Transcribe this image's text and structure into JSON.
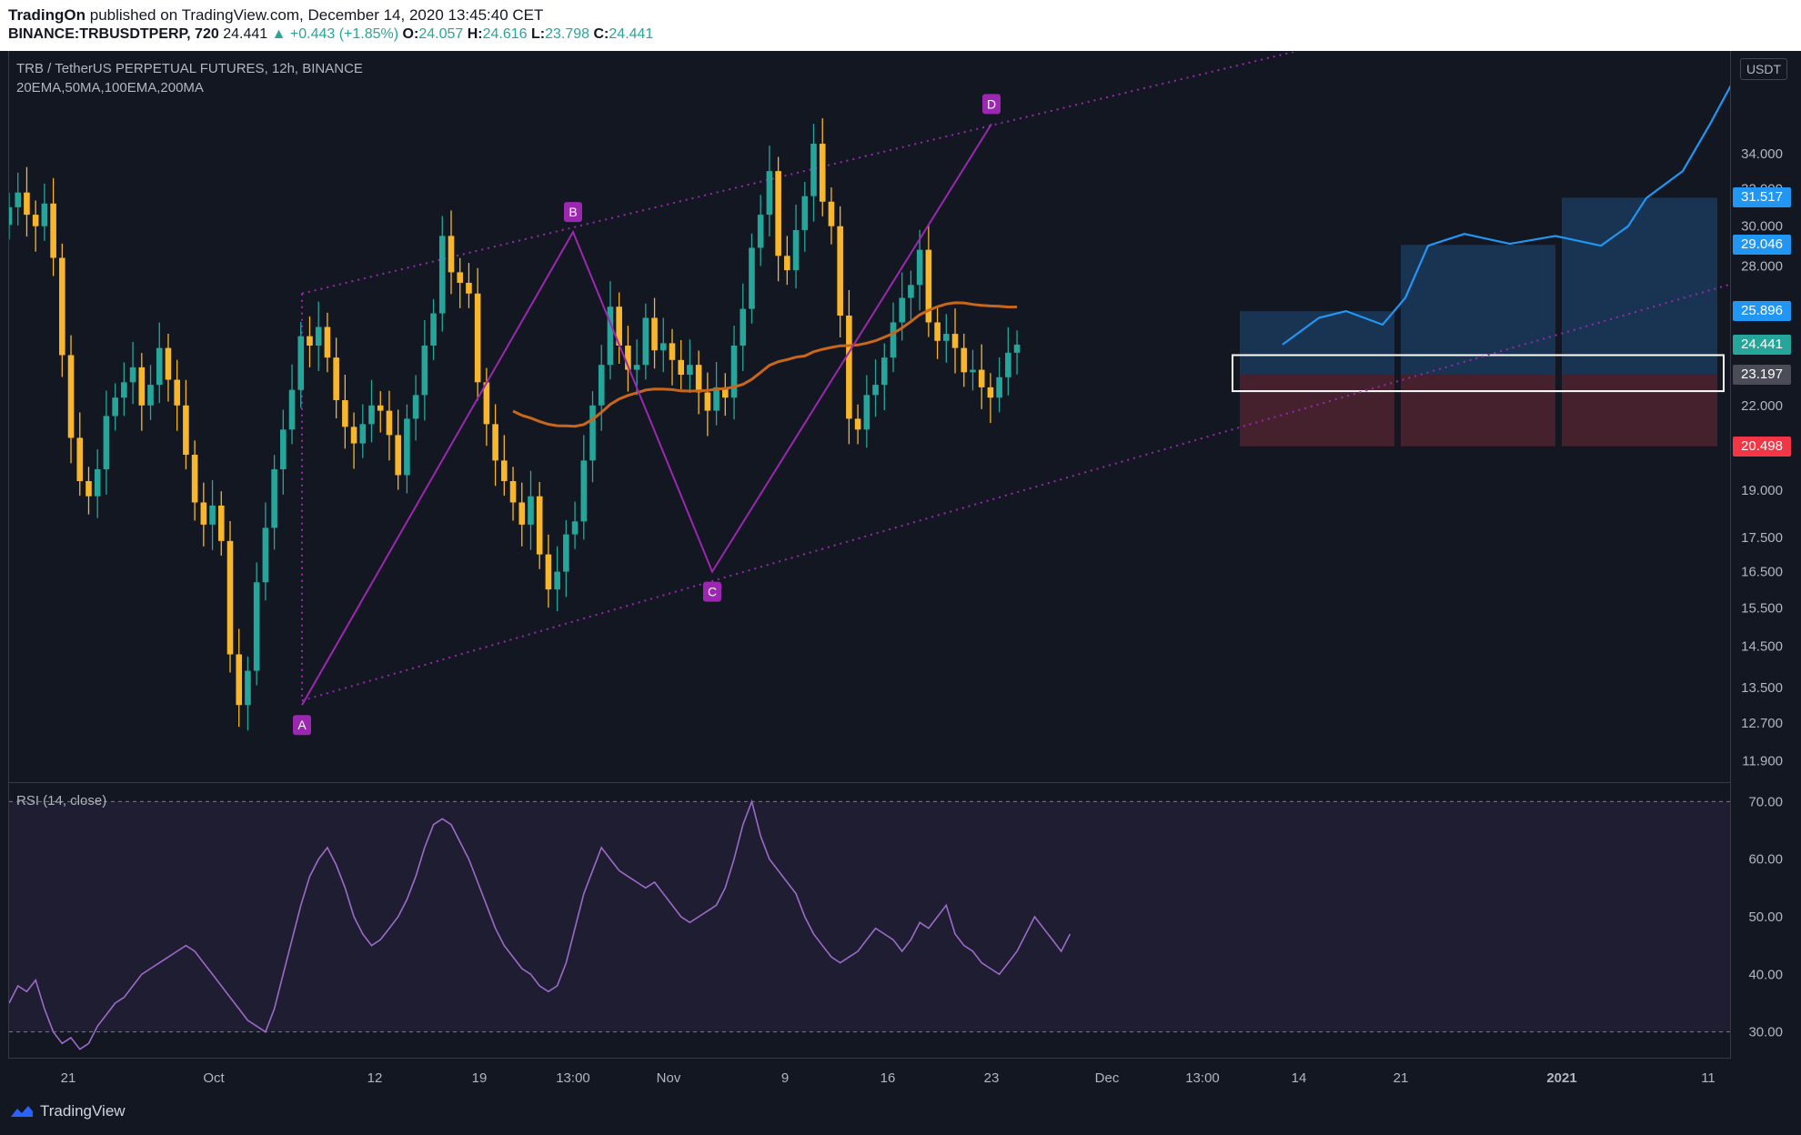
{
  "header": {
    "publisher": "TradingOn",
    "published_text": "published on TradingView.com, December 14, 2020 13:45:40 CET",
    "symbol": "BINANCE:TRBUSDTPERP, 720",
    "last": "24.441",
    "change": "+0.443 (+1.85%)",
    "o_label": "O:",
    "o": "24.057",
    "h_label": "H:",
    "h": "24.616",
    "l_label": "L:",
    "l": "23.798",
    "c_label": "C:",
    "c": "24.441"
  },
  "pane_title": "TRB / TetherUS PERPETUAL FUTURES, 12h, BINANCE",
  "indicators_label": "20EMA,50MA,100EMA,200MA",
  "rsi_label": "RSI (14, close)",
  "currency": "USDT",
  "footer_brand": "TradingView",
  "colors": {
    "background": "#131722",
    "up": "#26a69a",
    "down": "#f7b62c",
    "pattern": "#9c27b0",
    "ma": "#c8671a",
    "projection": "#2196f3",
    "rsi": "#9c6bc8"
  },
  "chart_data": [
    {
      "type": "candlestick",
      "title": "TRB / TetherUS PERPETUAL FUTURES, 12h, BINANCE",
      "y_axis": {
        "ticks": [
          "11.900",
          "12.700",
          "13.500",
          "14.500",
          "15.500",
          "16.500",
          "17.500",
          "19.000",
          "22.000",
          "26.000",
          "28.000",
          "30.000",
          "32.000",
          "34.000"
        ],
        "scale": "log",
        "range": [
          11.5,
          40.5
        ]
      },
      "x_axis": {
        "ticks": [
          "21",
          "Oct",
          "12",
          "19",
          "13:00",
          "Nov",
          "9",
          "16",
          "23",
          "Dec",
          "13:00",
          "14",
          "21",
          "2021",
          "11"
        ]
      },
      "price_labels": [
        {
          "value": "31.517",
          "color": "#2196f3"
        },
        {
          "value": "29.046",
          "color": "#2196f3"
        },
        {
          "value": "25.896",
          "color": "#2196f3"
        },
        {
          "value": "24.441",
          "color": "#26a69a"
        },
        {
          "value": "23.197",
          "color": "#4a4d57"
        },
        {
          "value": "20.498",
          "color": "#f23645"
        }
      ],
      "pattern_points": [
        {
          "label": "A",
          "price": 13.1
        },
        {
          "label": "B",
          "price": 29.7
        },
        {
          "label": "C",
          "price": 16.5
        },
        {
          "label": "D",
          "price": 35.8
        }
      ],
      "channel": {
        "upper": [
          26.7,
          41.0
        ],
        "lower": [
          13.2,
          27.1
        ]
      },
      "target_zone": {
        "entry": 23.197,
        "stop": 20.498,
        "targets": [
          25.896,
          29.046,
          31.517
        ]
      },
      "close_series": [
        31,
        31.8,
        30.6,
        30,
        31.2,
        28.4,
        24,
        20.8,
        19.3,
        18.8,
        19.7,
        21.6,
        22.3,
        22.9,
        23.5,
        22,
        22.8,
        24.3,
        23,
        22,
        20.2,
        18.6,
        17.9,
        18.5,
        17.4,
        14.3,
        13.1,
        13.9,
        16.2,
        17.8,
        19.7,
        21.1,
        22.6,
        24.8,
        24.4,
        25.2,
        23.9,
        22.2,
        21.2,
        20.6,
        21.3,
        22,
        21.8,
        20.9,
        19.5,
        21.5,
        22.4,
        24.4,
        25.8,
        29.5,
        27.7,
        27.2,
        26.7,
        22.9,
        21.3,
        20,
        19.3,
        18.6,
        17.9,
        18.8,
        17,
        16,
        16.5,
        17.6,
        18,
        20,
        22,
        23.6,
        26.1,
        24.4,
        23.4,
        23.6,
        25.6,
        24.2,
        24.5,
        23.8,
        23.2,
        23.6,
        22.5,
        21.8,
        22.7,
        22.3,
        24.4,
        26,
        28.9,
        30.6,
        33,
        28.5,
        27.8,
        29.8,
        31.6,
        34.6,
        31.3,
        30,
        25.7,
        21.5,
        21.1,
        22.4,
        22.8,
        23.9,
        25.4,
        26.5,
        27.1,
        28.8,
        25.4,
        24.6,
        24.9,
        24.3,
        23.3,
        23.4,
        22.7,
        22.3,
        23.1,
        24.1,
        24.441
      ],
      "projection_note": "blue projected path from 24.441 rising to ~40"
    },
    {
      "type": "line",
      "title": "RSI (14, close)",
      "y_axis": {
        "ticks": [
          "30.00",
          "40.00",
          "50.00",
          "60.00",
          "70.00"
        ],
        "range": [
          26,
          71
        ]
      },
      "bands": [
        30,
        70
      ],
      "values": [
        35,
        38,
        37,
        39,
        34,
        30,
        28,
        29,
        27,
        28,
        31,
        33,
        35,
        36,
        38,
        40,
        41,
        42,
        43,
        44,
        45,
        44,
        42,
        40,
        38,
        36,
        34,
        32,
        31,
        30,
        34,
        40,
        46,
        52,
        57,
        60,
        62,
        59,
        55,
        50,
        47,
        45,
        46,
        48,
        50,
        53,
        57,
        62,
        66,
        67,
        66,
        63,
        60,
        56,
        52,
        48,
        45,
        43,
        41,
        40,
        38,
        37,
        38,
        42,
        48,
        54,
        58,
        62,
        60,
        58,
        57,
        56,
        55,
        56,
        54,
        52,
        50,
        49,
        50,
        51,
        52,
        55,
        60,
        66,
        70,
        64,
        60,
        58,
        56,
        54,
        50,
        47,
        45,
        43,
        42,
        43,
        44,
        46,
        48,
        47,
        46,
        44,
        46,
        49,
        48,
        50,
        52,
        47,
        45,
        44,
        42,
        41,
        40,
        42,
        44,
        47,
        50,
        48,
        46,
        44,
        47
      ]
    }
  ]
}
